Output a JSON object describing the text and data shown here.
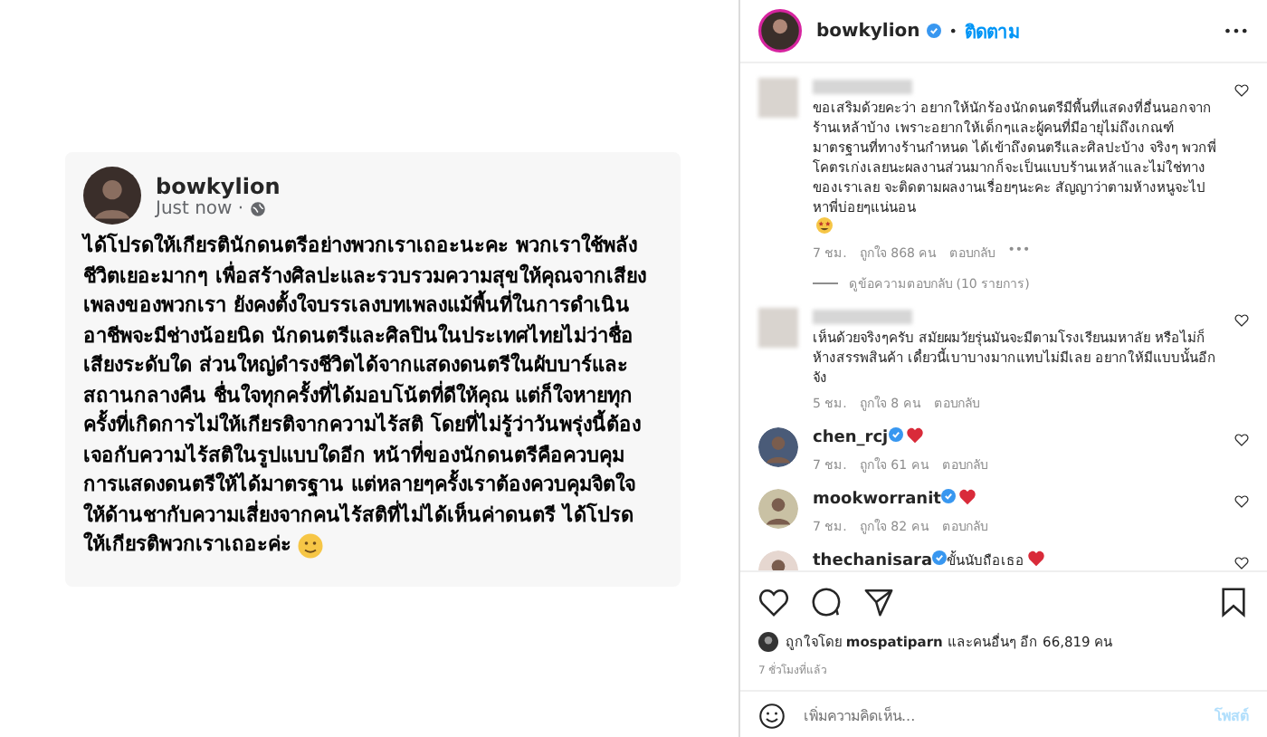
{
  "post_card": {
    "username": "bowkylion",
    "time": "Just now ·",
    "lines": [
      "ได้โปรดให้เกียรตินักดนตรีอย่างพวกเราเถอะนะคะ พวกเราใช้พลัง",
      "ชีวิตเยอะมากๆ เพื่อสร้างศิลปะและรวบรวมความสุขให้คุณจากเสียง",
      "เพลงของพวกเรา ยังคงตั้งใจบรรเลงบทเพลงแม้พื้นที่ในการดำเนิน",
      "อาชีพจะมีช่างน้อยนิด นักดนตรีและศิลปินในประเทศไทยไม่ว่าชื่อ",
      "เสียงระดับใด ส่วนใหญ่ดำรงชีวิตได้จากแสดงดนตรีในผับบาร์และ",
      "สถานกลางคืน ชื่นใจทุกครั้งที่ได้มอบโน้ตที่ดีให้คุณ แต่ก็ใจหายทุก",
      "ครั้งที่เกิดการไม่ให้เกียรติจากความไร้สติ โดยที่ไม่รู้ว่าวันพรุ่งนี้ต้อง",
      "เจอกับความไร้สติในรูปแบบใดอีก หน้าที่ของนักดนตรีคือควบคุม",
      "การแสดงดนตรีให้ได้มาตรฐาน แต่หลายๆครั้งเราต้องควบคุมจิตใจ",
      "ให้ด้านชากับความเสี่ยงจากคนไร้สติที่ไม่ได้เห็นค่าดนตรี ได้โปรด",
      "ให้เกียรติพวกเราเถอะค่ะ"
    ]
  },
  "header": {
    "username": "bowkylion",
    "dot": "•",
    "follow": "ติดตาม",
    "more": "•••"
  },
  "comments": [
    {
      "hidden_user": true,
      "text": "ขอเสริมด้วยคะว่า อยากให้นักร้องนักดนตรีมีพื้นที่แสดงที่อื่นนอกจากร้านเหล้าบ้าง เพราะอยากให้เด็กๆและผู้คนที่มีอายุไม่ถึงเกณฑ์มาตรฐานที่ทางร้านกำหนด ได้เข้าถึงดนตรีและศิลปะบ้าง จริงๆ พวกพี่โคตรเก่งเลยนะผลงานส่วนมากก็จะเป็นแบบร้านเหล้าและไม่ใช่ทางของเราเลย จะติดตามผลงานเรื่อยๆนะคะ สัญญาว่าตามห้างหนูจะไปหาพี่บ่อยๆแน่นอน",
      "kind": "emoji",
      "time": "7 ชม.",
      "likes": "ถูกใจ 868 คน",
      "reply": "ตอบกลับ",
      "more": "•••",
      "view_replies": "ดูข้อความตอบกลับ (10 รายการ)"
    },
    {
      "hidden_user": true,
      "text": "เห็นด้วยจริงๆครับ สมัยผมวัยรุ่นมันจะมีตามโรงเรียนมหาลัย หรือไม่ก็ห้างสรรพสินค้า เดี๋ยวนี้เบาบางมากแทบไม่มีเลย อยากให้มีแบบนั้นอีกจัง",
      "kind": "plain",
      "time": "5 ชม.",
      "likes": "ถูกใจ 8 คน",
      "reply": "ตอบกลับ"
    },
    {
      "hidden_user": false,
      "username": "chen_rcj",
      "kind": "heart",
      "time": "7 ชม.",
      "likes": "ถูกใจ 61 คน",
      "reply": "ตอบกลับ"
    },
    {
      "hidden_user": false,
      "username": "mookworranit",
      "kind": "heart",
      "time": "7 ชม.",
      "likes": "ถูกใจ 82 คน",
      "reply": "ตอบกลับ"
    },
    {
      "hidden_user": false,
      "username": "thechanisara",
      "text": "ขั้นนับถือเธอ",
      "kind": "heart"
    }
  ],
  "likes_line": {
    "prefix": "ถูกใจโดย",
    "user": "mospatiparn",
    "rest": "และคนอื่นๆ อีก 66,819 คน"
  },
  "time_ago": "7 ชั่วโมงที่แล้ว",
  "comment_box": {
    "placeholder": "เพิ่มความคิดเห็น...",
    "post": "โพสต์"
  }
}
